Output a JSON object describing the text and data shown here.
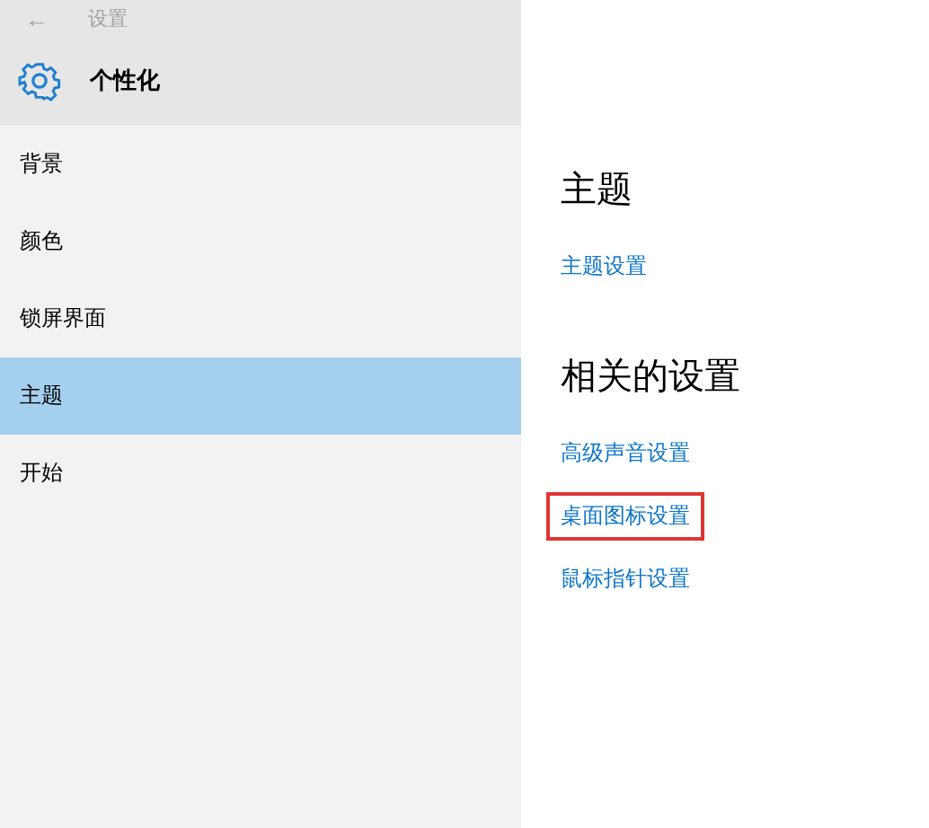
{
  "window": {
    "title": "设置",
    "back": "←"
  },
  "header": {
    "title": "个性化"
  },
  "nav": [
    {
      "label": "背景",
      "selected": false
    },
    {
      "label": "颜色",
      "selected": false
    },
    {
      "label": "锁屏界面",
      "selected": false
    },
    {
      "label": "主题",
      "selected": true
    },
    {
      "label": "开始",
      "selected": false
    }
  ],
  "sections": [
    {
      "heading": "主题",
      "links": [
        {
          "label": "主题设置",
          "highlighted": false
        }
      ]
    },
    {
      "heading": "相关的设置",
      "links": [
        {
          "label": "高级声音设置",
          "highlighted": false
        },
        {
          "label": "桌面图标设置",
          "highlighted": true
        },
        {
          "label": "鼠标指针设置",
          "highlighted": false
        }
      ]
    }
  ]
}
